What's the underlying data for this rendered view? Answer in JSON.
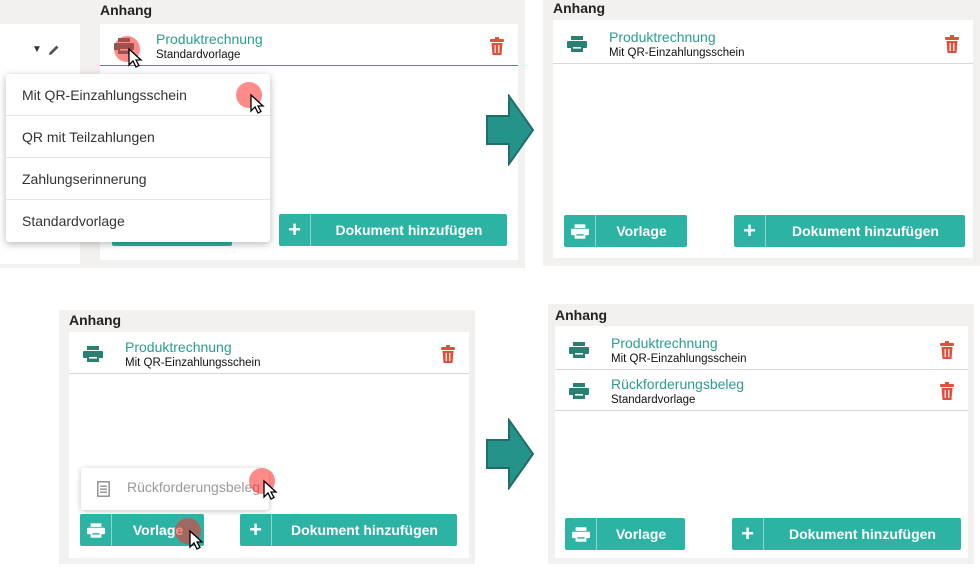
{
  "colors": {
    "accent": "#2cb3a3",
    "link": "#2a9d8f",
    "trash": "#e0503a",
    "panel": "#f3f1ef"
  },
  "icons": {
    "printer": "printer-icon",
    "trash": "trash-icon",
    "plus": "plus-icon",
    "document": "document-icon",
    "arrow": "arrow-right-icon",
    "cursor": "cursor-icon"
  },
  "panel1": {
    "title": "Anhang",
    "item": {
      "name": "Produktrechnung",
      "sub": "Standardvorlage"
    },
    "dropdown": [
      "Mit QR-Einzahlungsschein",
      "QR mit Teilzahlungen",
      "Zahlungserinnerung",
      "Standardvorlage"
    ],
    "add_label": "Dokument hinzufügen"
  },
  "panel2": {
    "title": "Anhang",
    "item": {
      "name": "Produktrechnung",
      "sub": "Mit QR-Einzahlungsschein"
    },
    "template_label": "Vorlage",
    "add_label": "Dokument hinzufügen"
  },
  "panel3": {
    "title": "Anhang",
    "item": {
      "name": "Produktrechnung",
      "sub": "Mit QR-Einzahlungsschein"
    },
    "popup_label": "Rückforderungsbeleg",
    "template_label": "Vorlage",
    "add_label": "Dokument hinzufügen"
  },
  "panel4": {
    "title": "Anhang",
    "items": [
      {
        "name": "Produktrechnung",
        "sub": "Mit QR-Einzahlungsschein"
      },
      {
        "name": "Rückforderungsbeleg",
        "sub": "Standardvorlage"
      }
    ],
    "template_label": "Vorlage",
    "add_label": "Dokument hinzufügen"
  }
}
